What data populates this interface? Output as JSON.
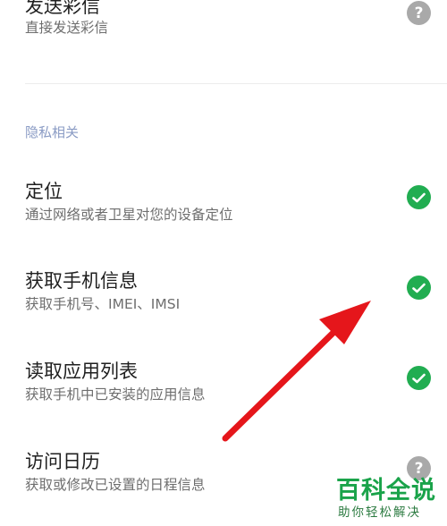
{
  "items": [
    {
      "title": "发送彩信",
      "subtitle": "直接发送彩信",
      "status": "help"
    },
    {
      "title": "定位",
      "subtitle": "通过网络或者卫星对您的设备定位",
      "status": "ok"
    },
    {
      "title": "获取手机信息",
      "subtitle": "获取手机号、IMEI、IMSI",
      "status": "ok"
    },
    {
      "title": "读取应用列表",
      "subtitle": "获取手机中已安装的应用信息",
      "status": "ok"
    },
    {
      "title": "访问日历",
      "subtitle": "获取或修改已设置的日程信息",
      "status": "help"
    }
  ],
  "section_header": "隐私相关",
  "help_glyph": "?",
  "watermark": {
    "logo": "百科全说",
    "tagline": "助你轻松解决"
  },
  "colors": {
    "ok": "#21ad51",
    "help": "#a9a9a9",
    "section": "#8a9bc4",
    "arrow": "#e5161b",
    "watermark": "#1aa34a"
  },
  "icons": {
    "ok": "check-circle-icon",
    "help": "question-circle-icon"
  }
}
